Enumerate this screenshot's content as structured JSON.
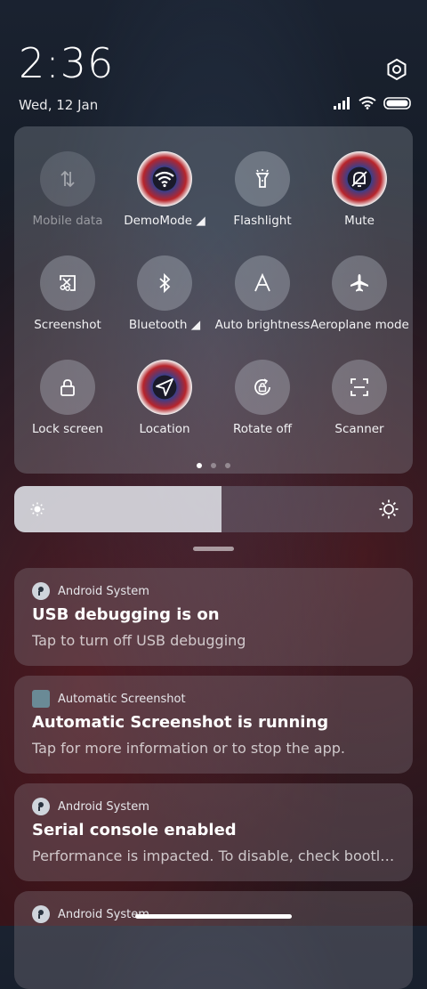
{
  "status": {
    "time": "2:36",
    "date": "Wed, 12 Jan"
  },
  "tiles": [
    {
      "label": "Mobile data",
      "icon": "mobile-data-icon",
      "state": "disabled"
    },
    {
      "label": "DemoMode",
      "icon": "wifi-icon",
      "state": "active"
    },
    {
      "label": "Flashlight",
      "icon": "flashlight-icon",
      "state": "off"
    },
    {
      "label": "Mute",
      "icon": "mute-icon",
      "state": "active"
    },
    {
      "label": "Screenshot",
      "icon": "screenshot-icon",
      "state": "off"
    },
    {
      "label": "Bluetooth",
      "icon": "bluetooth-icon",
      "state": "off"
    },
    {
      "label": "Auto brightness",
      "icon": "auto-brightness-icon",
      "state": "off"
    },
    {
      "label": "Aeroplane mode",
      "icon": "airplane-icon",
      "state": "off"
    },
    {
      "label": "Lock screen",
      "icon": "lock-icon",
      "state": "off"
    },
    {
      "label": "Location",
      "icon": "location-icon",
      "state": "active"
    },
    {
      "label": "Rotate off",
      "icon": "rotate-lock-icon",
      "state": "off"
    },
    {
      "label": "Scanner",
      "icon": "scanner-icon",
      "state": "off"
    }
  ],
  "page_indicator": {
    "pages": 3,
    "current": 1
  },
  "brightness": {
    "level": 0.52
  },
  "notifications": [
    {
      "app": "Android System",
      "icon": "android-system-icon",
      "title": "USB debugging is on",
      "body": "Tap to turn off USB debugging"
    },
    {
      "app": "Automatic Screenshot",
      "icon": "automatic-screenshot-icon",
      "title": "Automatic Screenshot is running",
      "body": "Tap for more information or to stop the app."
    },
    {
      "app": "Android System",
      "icon": "android-system-icon",
      "title": "Serial console enabled",
      "body": "Performance is impacted. To disable, check bootloader."
    },
    {
      "app": "Android System",
      "icon": "android-system-icon",
      "title": "",
      "body": ""
    }
  ]
}
